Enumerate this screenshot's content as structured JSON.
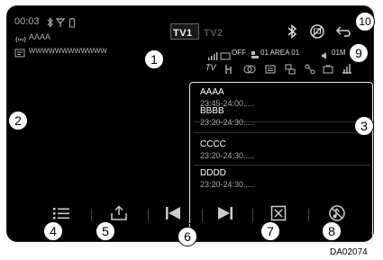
{
  "status": {
    "time": "00:03",
    "station_name": "AAAA",
    "url": "wwwwwwwwwwww"
  },
  "tabs": [
    "TV1",
    "TV2"
  ],
  "signal_row": {
    "off_label": "OFF",
    "area_label": "01 AREA 01",
    "volume_label": "01M",
    "tv_label": "TV"
  },
  "programs": [
    {
      "name": "AAAA",
      "time": "23:45-24:00....."
    },
    {
      "name": "BBBB",
      "time": "23:20-24:30....."
    },
    {
      "name": "CCCC",
      "time": "23:20-24:30....."
    },
    {
      "name": "DDDD",
      "time": "23:20-24:30....."
    }
  ],
  "callouts": [
    "1",
    "2",
    "3",
    "4",
    "5",
    "6",
    "7",
    "8",
    "9",
    "10"
  ],
  "code": "DA02074",
  "icons": {
    "bluetooth": "bluetooth-icon",
    "no_signal": "no-signal-icon",
    "back": "back-icon",
    "list": "list-icon",
    "upload": "upload-icon",
    "prev": "skip-previous-icon",
    "next": "skip-next-icon",
    "close": "close-box-icon",
    "no_music": "no-music-icon"
  }
}
